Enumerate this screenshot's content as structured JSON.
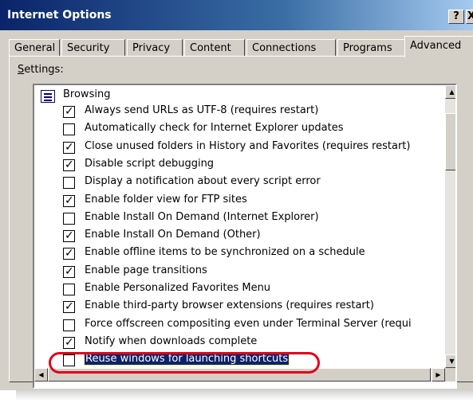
{
  "window": {
    "title": "Internet Options",
    "help_glyph": "?",
    "close_glyph": "X"
  },
  "tabs": [
    {
      "label": "General"
    },
    {
      "label": "Security"
    },
    {
      "label": "Privacy"
    },
    {
      "label": "Content"
    },
    {
      "label": "Connections"
    },
    {
      "label": "Programs"
    },
    {
      "label": "Advanced",
      "active": true
    }
  ],
  "settings": {
    "label_accesskey": "S",
    "label_rest": "ettings:",
    "group": {
      "label": "Browsing",
      "icon": "settings-group-icon"
    },
    "items": [
      {
        "label": "Always send URLs as UTF-8 (requires restart)",
        "checked": true
      },
      {
        "label": "Automatically check for Internet Explorer updates",
        "checked": false
      },
      {
        "label": "Close unused folders in History and Favorites (requires restart)",
        "checked": true
      },
      {
        "label": "Disable script debugging",
        "checked": true
      },
      {
        "label": "Display a notification about every script error",
        "checked": false
      },
      {
        "label": "Enable folder view for FTP sites",
        "checked": true
      },
      {
        "label": "Enable Install On Demand (Internet Explorer)",
        "checked": false
      },
      {
        "label": "Enable Install On Demand (Other)",
        "checked": true
      },
      {
        "label": "Enable offline items to be synchronized on a schedule",
        "checked": true
      },
      {
        "label": "Enable page transitions",
        "checked": true
      },
      {
        "label": "Enable Personalized Favorites Menu",
        "checked": false
      },
      {
        "label": "Enable third-party browser extensions (requires restart)",
        "checked": true
      },
      {
        "label": "Force offscreen compositing even under Terminal Server (requi",
        "checked": false
      },
      {
        "label": "Notify when downloads complete",
        "checked": true
      },
      {
        "label": "Reuse windows for launching shortcuts",
        "checked": false,
        "selected": true
      }
    ]
  },
  "scrollbars": {
    "up_arrow": "▲",
    "down_arrow": "▼",
    "left_arrow": "◀",
    "right_arrow": "▶"
  },
  "colors": {
    "highlight_ring": "#e0001b",
    "selection": "#0a246a",
    "titlebar": "#0a246a"
  }
}
